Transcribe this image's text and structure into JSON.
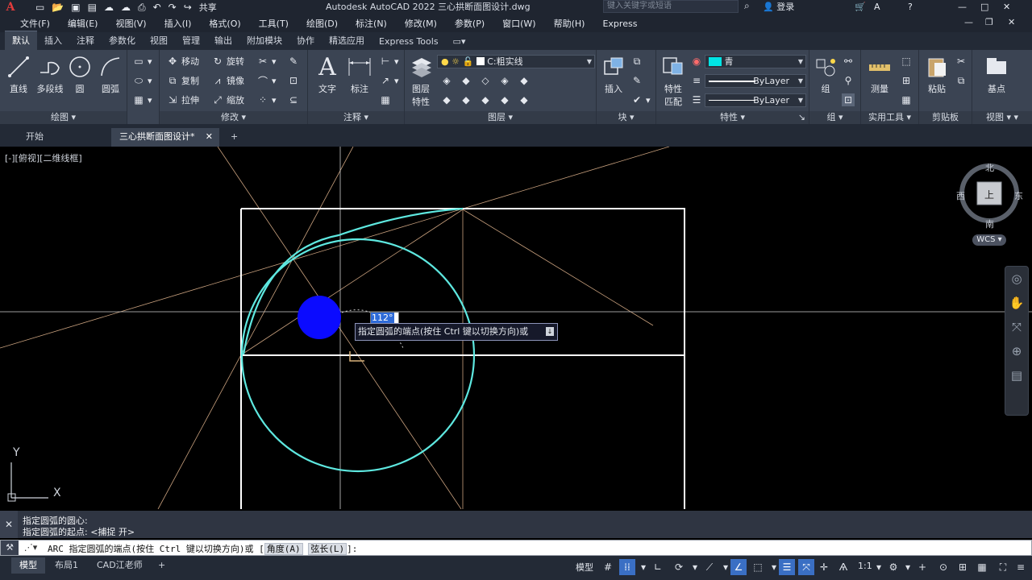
{
  "app": {
    "title": "Autodesk AutoCAD 2022    三心拱断面图设计.dwg",
    "search_placeholder": "键入关键字或短语",
    "login_label": "登录",
    "share_label": "共享"
  },
  "menu": [
    "文件(F)",
    "编辑(E)",
    "视图(V)",
    "插入(I)",
    "格式(O)",
    "工具(T)",
    "绘图(D)",
    "标注(N)",
    "修改(M)",
    "参数(P)",
    "窗口(W)",
    "帮助(H)",
    "Express"
  ],
  "ribbon_tabs": [
    "默认",
    "插入",
    "注释",
    "参数化",
    "视图",
    "管理",
    "输出",
    "附加模块",
    "协作",
    "精选应用",
    "Express Tools"
  ],
  "draw_panel": {
    "title": "绘图",
    "line": "直线",
    "polyline": "多段线",
    "circle": "圆",
    "arc": "圆弧"
  },
  "modify_panel": {
    "title": "修改",
    "move": "移动",
    "rotate": "旋转",
    "copy": "复制",
    "mirror": "镜像",
    "stretch": "拉伸",
    "scale": "缩放"
  },
  "annotation_panel": {
    "title": "注释",
    "text": "文字",
    "dimension": "标注"
  },
  "layers_panel": {
    "title": "图层",
    "layer_props_line1": "图层",
    "layer_props_line2": "特性",
    "current_layer": "C:粗实线"
  },
  "block_panel": {
    "title": "块",
    "insert": "插入"
  },
  "properties_panel": {
    "title": "特性",
    "match_line1": "特性",
    "match_line2": "匹配",
    "color_value": "青",
    "color_hex": "#00e5e5",
    "linetype_value": "ByLayer",
    "lineweight_value": "ByLayer"
  },
  "groups_panel": {
    "title": "组",
    "group": "组"
  },
  "utilities_panel": {
    "title": "实用工具",
    "measure": "测量"
  },
  "clipboard_panel": {
    "title": "剪贴板",
    "paste": "粘贴"
  },
  "view_panel": {
    "title": "视图",
    "base": "基点"
  },
  "doc_tabs": {
    "start": "开始",
    "current": "三心拱断面图设计*"
  },
  "viewport_label": "[-][俯视][二维线框]",
  "viewcube": {
    "north": "北",
    "south": "南",
    "east": "东",
    "west": "西",
    "face": "上",
    "wcs": "WCS"
  },
  "dynamic_input": {
    "angle": "112°",
    "prompt": "指定圆弧的端点(按住 Ctrl 键以切换方向)或"
  },
  "ucs": {
    "x": "X",
    "y": "Y"
  },
  "command_history": [
    "指定圆弧的圆心:",
    "指定圆弧的起点: <捕捉 开>"
  ],
  "command_line": {
    "prefix": "ARC 指定圆弧的端点(按住 Ctrl 键以切换方向)或 [",
    "opt_angle": "角度(A)",
    "opt_chord": "弦长(L)",
    "suffix": "]:"
  },
  "layout_tabs": [
    "模型",
    "布局1",
    "CAD江老师"
  ],
  "status": {
    "model_label": "模型",
    "scale": "1:1"
  },
  "colors": {
    "accent_blue": "#3a6fc4",
    "geometry_white": "#ffffff",
    "geometry_cyan": "#5ee8e0",
    "construction": "#caa88a"
  }
}
